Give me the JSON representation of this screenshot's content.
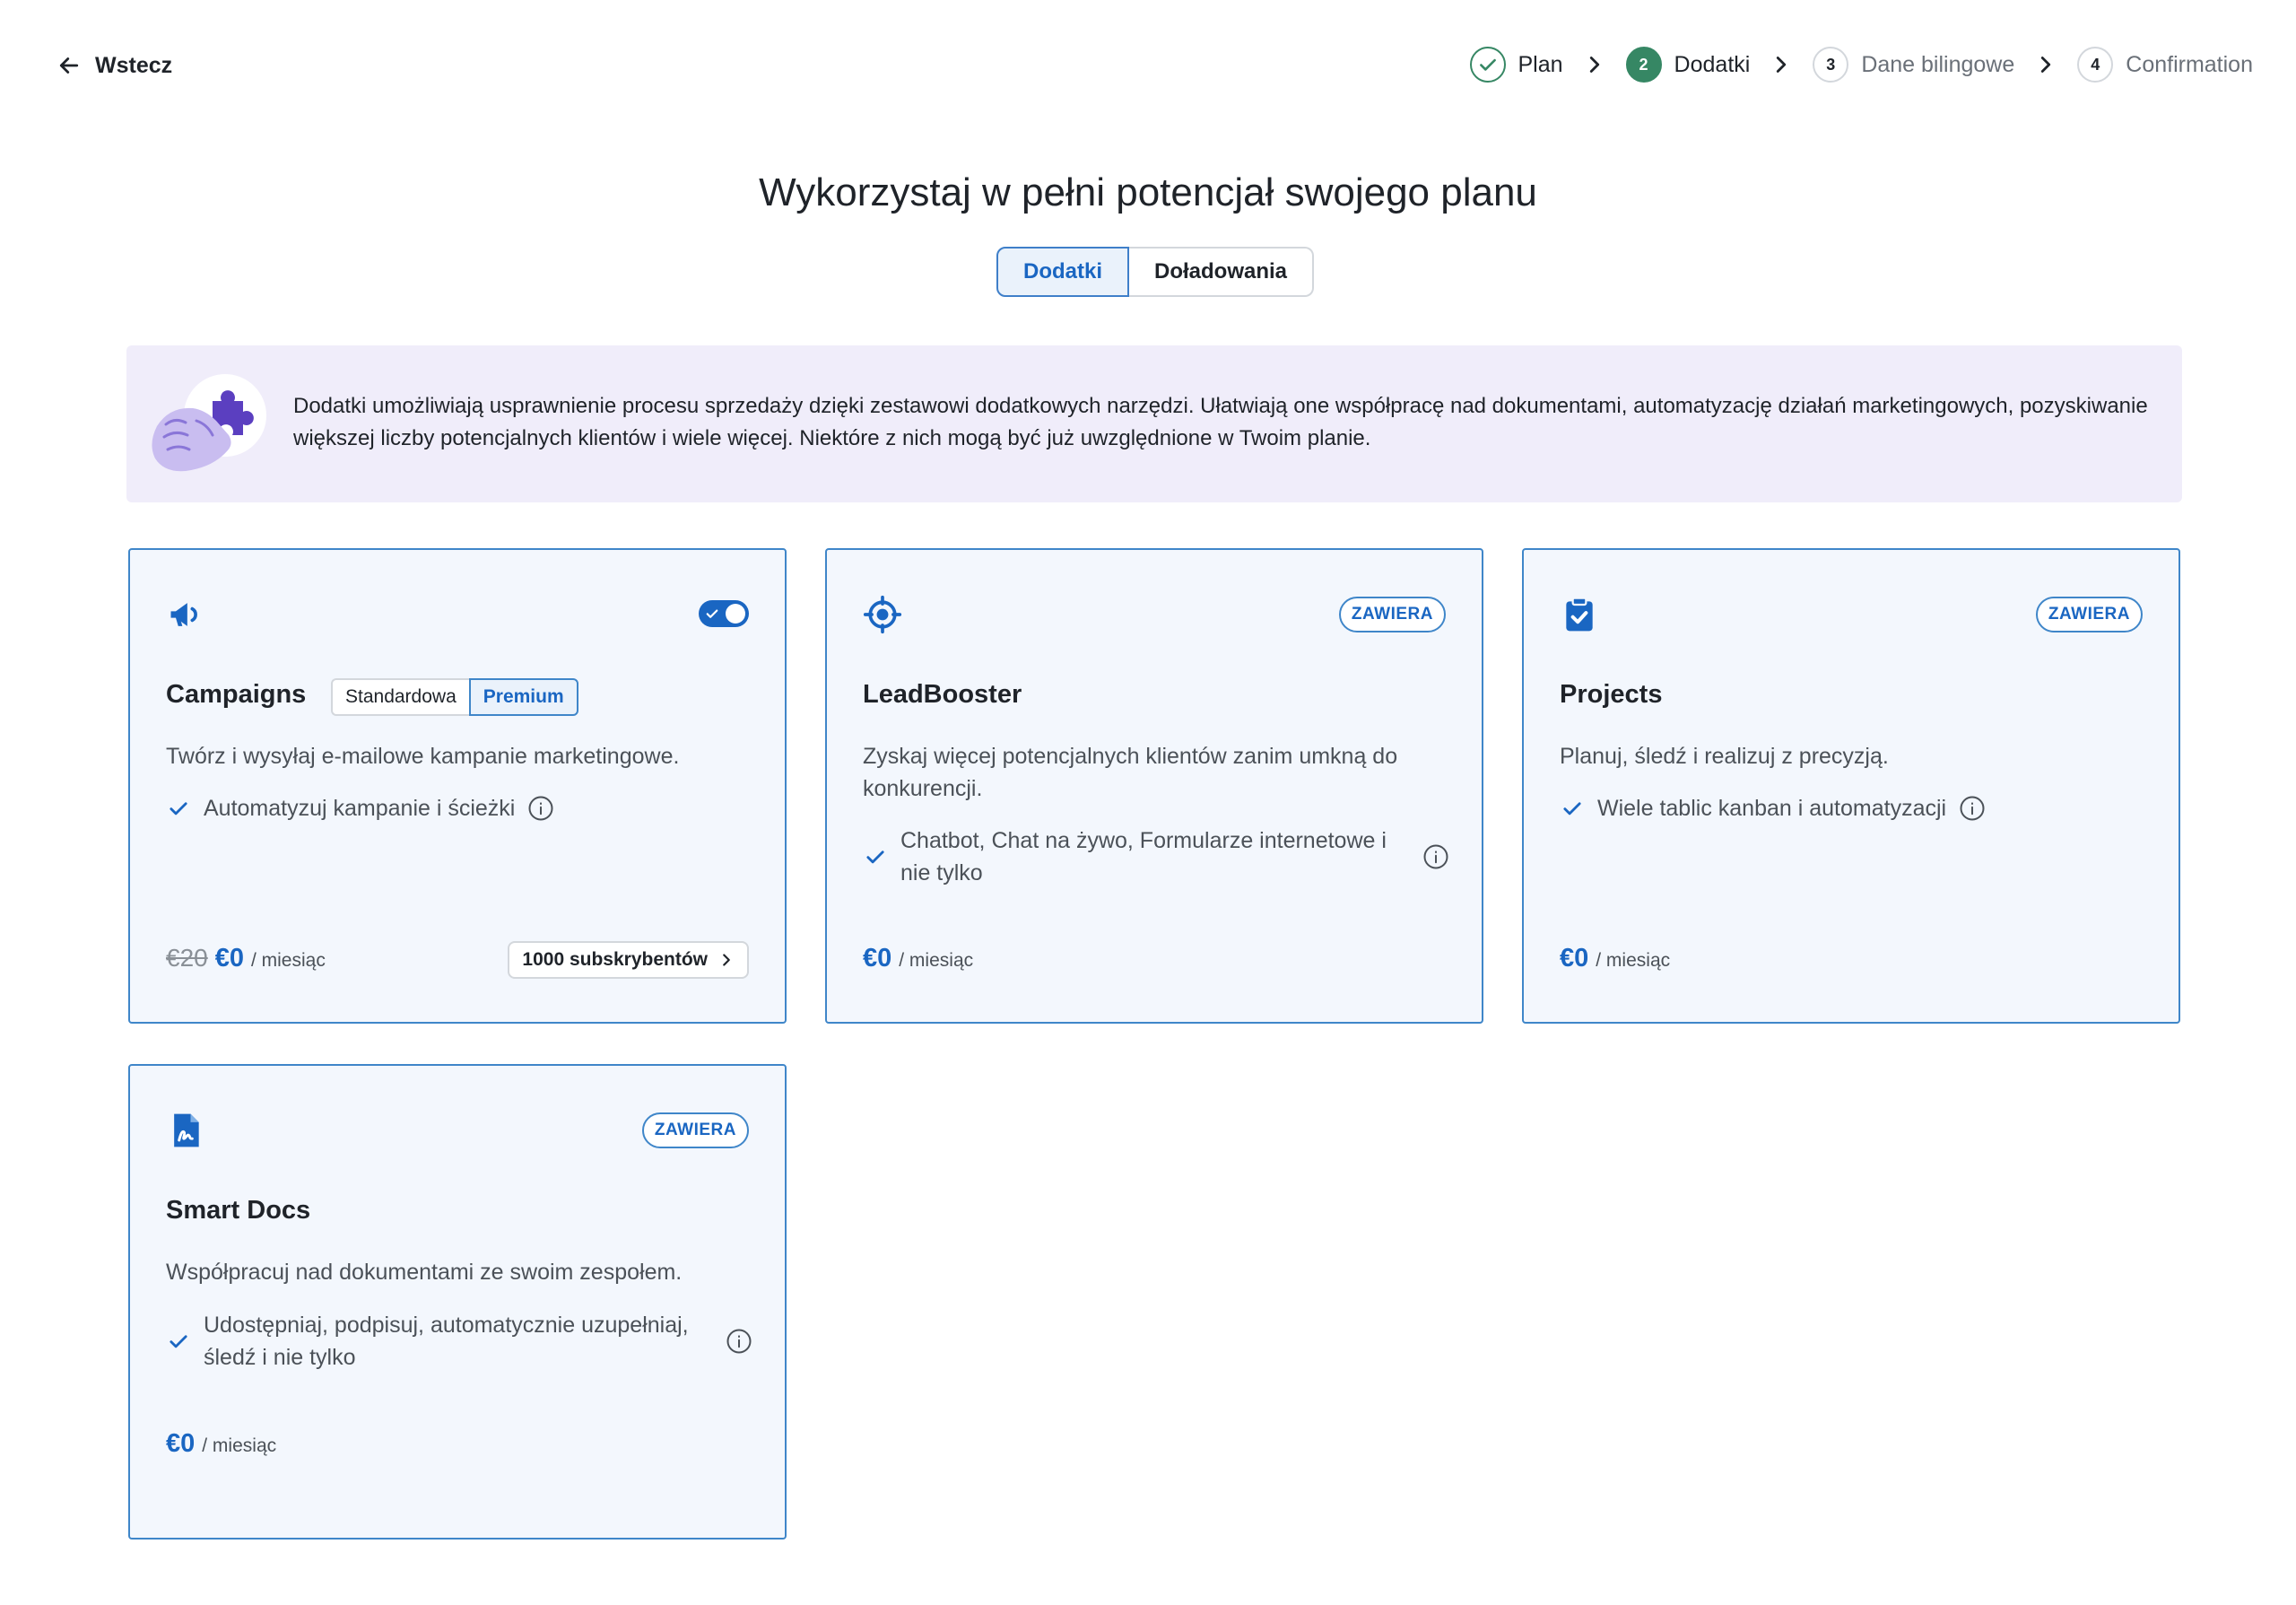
{
  "header": {
    "back_label": "Wstecz",
    "steps": [
      {
        "number": "",
        "label": "Plan",
        "state": "done"
      },
      {
        "number": "2",
        "label": "Dodatki",
        "state": "current"
      },
      {
        "number": "3",
        "label": "Dane bilingowe",
        "state": "upcoming"
      },
      {
        "number": "4",
        "label": "Confirmation",
        "state": "upcoming"
      }
    ]
  },
  "page": {
    "title": "Wykorzystaj w pełni potencjał swojego planu",
    "tabs": [
      "Dodatki",
      "Doładowania"
    ],
    "selected_tab": "Dodatki"
  },
  "banner": {
    "text": "Dodatki umożliwiają usprawnienie procesu sprzedaży dzięki zestawowi dodatkowych narzędzi. Ułatwiają one współpracę nad dokumentami, automatyzację działań marketingowych, pozyskiwanie większej liczby potencjalnych klientów i wiele więcej. Niektóre z nich mogą być już uwzględnione w Twoim planie."
  },
  "cards": [
    {
      "title": "Campaigns",
      "icon": "megaphone-icon",
      "toggle_on": true,
      "variants": [
        "Standardowa",
        "Premium"
      ],
      "selected_variant": "Premium",
      "description": "Twórz i wysyłaj e-mailowe kampanie marketingowe.",
      "feature": "Automatyzuj kampanie i ścieżki",
      "old_price": "€20",
      "price": "€0",
      "per": "/ miesiąc",
      "subscribers": "1000 subskrybentów"
    },
    {
      "title": "LeadBooster",
      "icon": "target-icon",
      "badge": "ZAWIERA",
      "description": "Zyskaj więcej potencjalnych klientów zanim umkną do konkurencji.",
      "feature": "Chatbot, Chat na żywo, Formularze internetowe i nie tylko",
      "price": "€0",
      "per": "/ miesiąc"
    },
    {
      "title": "Projects",
      "icon": "clipboard-check-icon",
      "badge": "ZAWIERA",
      "description": "Planuj, śledź i realizuj z precyzją.",
      "feature": "Wiele tablic kanban i automatyzacji",
      "price": "€0",
      "per": "/ miesiąc"
    },
    {
      "title": "Smart Docs",
      "icon": "document-signature-icon",
      "badge": "ZAWIERA",
      "description": "Współpracuj nad dokumentami ze swoim zespołem.",
      "feature": "Udostępniaj, podpisuj, automatycznie uzupełniaj, śledź i nie tylko",
      "price": "€0",
      "per": "/ miesiąc"
    }
  ],
  "colors": {
    "accent": "#1a66c2",
    "success": "#368764",
    "card_border": "#3f86c9",
    "card_bg": "#f3f7fd",
    "banner_bg": "#f0edfa"
  }
}
